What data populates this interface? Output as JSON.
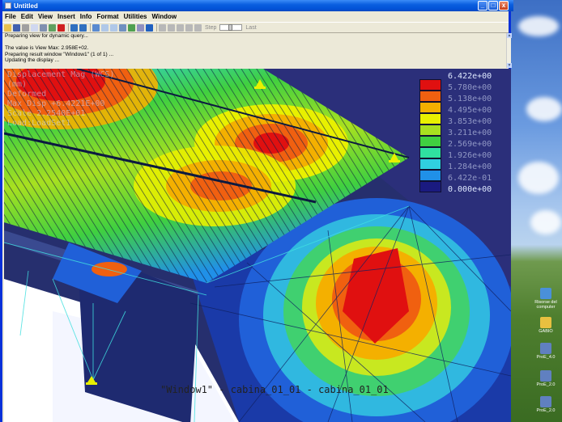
{
  "window": {
    "title": "Untitled",
    "buttons": {
      "minimize": "_",
      "maximize": "□",
      "close": "x"
    }
  },
  "menu": [
    "File",
    "Edit",
    "View",
    "Insert",
    "Info",
    "Format",
    "Utilities",
    "Window"
  ],
  "toolbar": {
    "step_label": "Step",
    "last_label": "Last"
  },
  "messages": [
    "Preparing view for dynamic query...",
    "",
    "The value is View Max:  2.958E+02.",
    "Preparing result window \"Window1\" (1 of 1) ...",
    "Updating the display ..."
  ],
  "graphics": {
    "info_lines": [
      "Displacement Mag (WCS)",
      "(mm)",
      "Deformed",
      "Max Disp +6.4221E+00",
      "Scale  2.2540E+01",
      "Load:LoadSet1"
    ],
    "legend": {
      "labels": [
        "6.422e+00",
        "5.780e+00",
        "5.138e+00",
        "4.495e+00",
        "3.853e+00",
        "3.211e+00",
        "2.569e+00",
        "1.926e+00",
        "1.284e+00",
        "6.422e-01",
        "0.000e+00"
      ],
      "colors": [
        "#e01010",
        "#f06010",
        "#f4b000",
        "#e8f000",
        "#a8e020",
        "#40d040",
        "#30e0a0",
        "#30d0e0",
        "#2090e8",
        "#2030d0",
        "#1a1a80"
      ]
    },
    "caption": "\"Window1\" - cabina_01_01 - cabina_01_01"
  },
  "desktop": {
    "icons": [
      {
        "label": "Risorse del computer",
        "color": "#4a90d9"
      },
      {
        "label": "GABIO",
        "color": "#e8c040"
      },
      {
        "label": "ProE_4.0",
        "color": "#6080c0"
      },
      {
        "label": "ProE_2.0",
        "color": "#6080c0"
      },
      {
        "label": "ProE_2.0",
        "color": "#6080c0"
      }
    ]
  },
  "colors": {
    "title_bar": "#0251d6",
    "window_bg": "#ece9d8",
    "graphics_bg": "#2a3a7a"
  }
}
